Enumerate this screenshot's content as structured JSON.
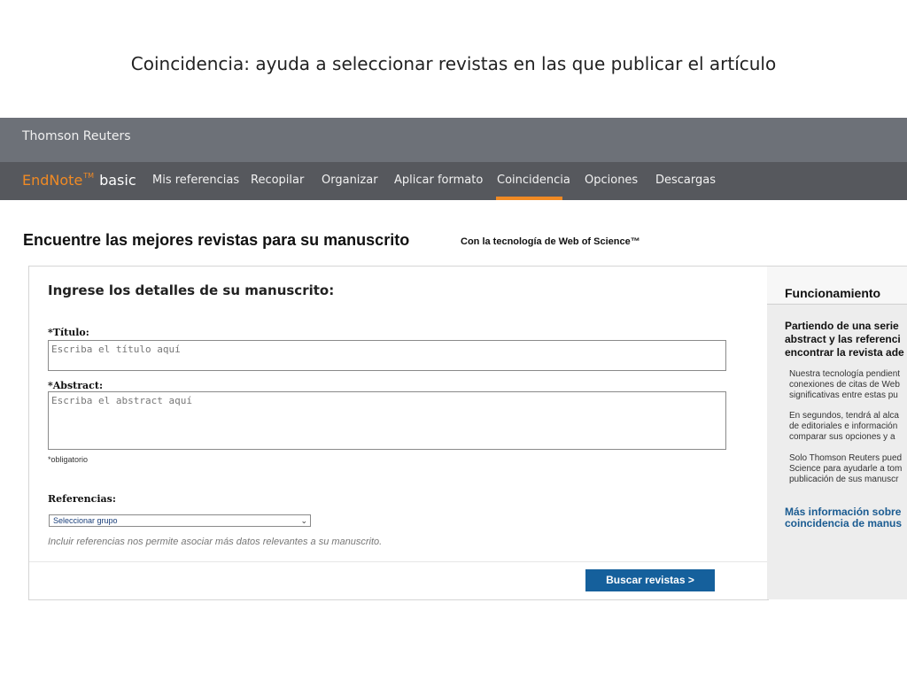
{
  "slide": {
    "title": "Coincidencia: ayuda a seleccionar revistas en las que publicar el artículo"
  },
  "header": {
    "brand": "Thomson Reuters",
    "logo": {
      "name": "EndNote",
      "tm": "TM",
      "suffix": "basic"
    },
    "nav": [
      {
        "label": "Mis referencias"
      },
      {
        "label": "Recopilar"
      },
      {
        "label": "Organizar"
      },
      {
        "label": "Aplicar formato"
      },
      {
        "label": "Coincidencia",
        "active": true
      },
      {
        "label": "Opciones"
      },
      {
        "label": "Descargas"
      }
    ]
  },
  "page": {
    "heading": "Encuentre las mejores revistas para su manuscrito",
    "powered_by": "Con la tecnología de Web of Science™"
  },
  "form": {
    "title": "Ingrese los detalles de su manuscrito:",
    "title_field": {
      "label": "*Título:",
      "placeholder": "Escriba el título aquí"
    },
    "abstract_field": {
      "label": "*Abstract:",
      "placeholder": "Escriba el abstract aquí"
    },
    "required_note": "*obligatorio",
    "references": {
      "label": "Referencias:",
      "selected": "Seleccionar grupo",
      "chevron": "chevron-down-icon"
    },
    "hint": "Incluir referencias nos permite asociar más datos relevantes a su manuscrito.",
    "submit_label": "Buscar revistas >"
  },
  "sidebar": {
    "title": "Funcionamiento",
    "lead_lines": [
      "Partiendo de una serie",
      "abstract y las referenci",
      "encontrar la revista ade"
    ],
    "paragraphs": [
      [
        "Nuestra tecnología pendient",
        "conexiones de citas de Web",
        "significativas entre estas pu"
      ],
      [
        "En segundos, tendrá al alca",
        "de editoriales e información",
        "comparar sus opciones y a"
      ],
      [
        "Solo Thomson Reuters pued",
        "Science para ayudarle a tom",
        "publicación de sus manuscr"
      ]
    ],
    "link_lines": [
      "Más información sobre",
      "coincidencia de manus"
    ]
  },
  "colors": {
    "brand_bar": "#6d7178",
    "nav_bar": "#56585d",
    "accent_orange": "#f08a24",
    "button_blue": "#15609c",
    "link_blue": "#1a5b91"
  }
}
